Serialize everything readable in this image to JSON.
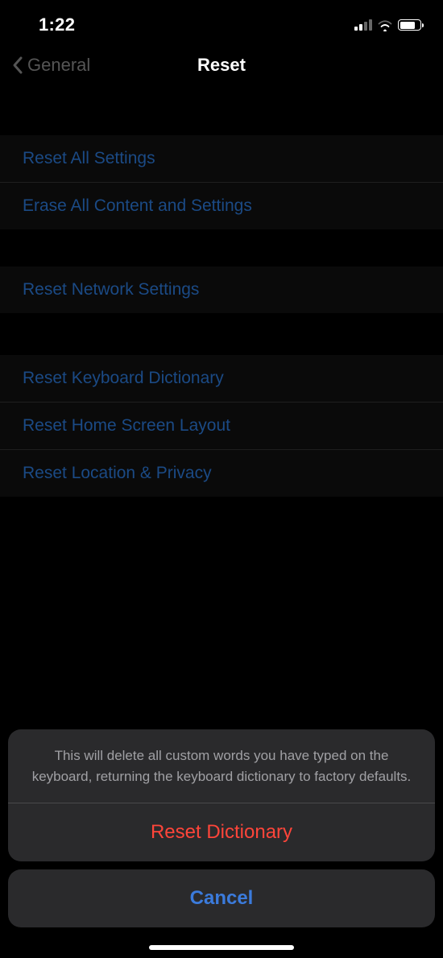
{
  "status": {
    "time": "1:22"
  },
  "nav": {
    "back_label": "General",
    "title": "Reset"
  },
  "groups": [
    {
      "items": [
        {
          "label": "Reset All Settings"
        },
        {
          "label": "Erase All Content and Settings"
        }
      ]
    },
    {
      "items": [
        {
          "label": "Reset Network Settings"
        }
      ]
    },
    {
      "items": [
        {
          "label": "Reset Keyboard Dictionary"
        },
        {
          "label": "Reset Home Screen Layout"
        },
        {
          "label": "Reset Location & Privacy"
        }
      ]
    }
  ],
  "action_sheet": {
    "message": "This will delete all custom words you have typed on the keyboard, returning the keyboard dictionary to factory defaults.",
    "destructive_label": "Reset Dictionary",
    "cancel_label": "Cancel"
  }
}
